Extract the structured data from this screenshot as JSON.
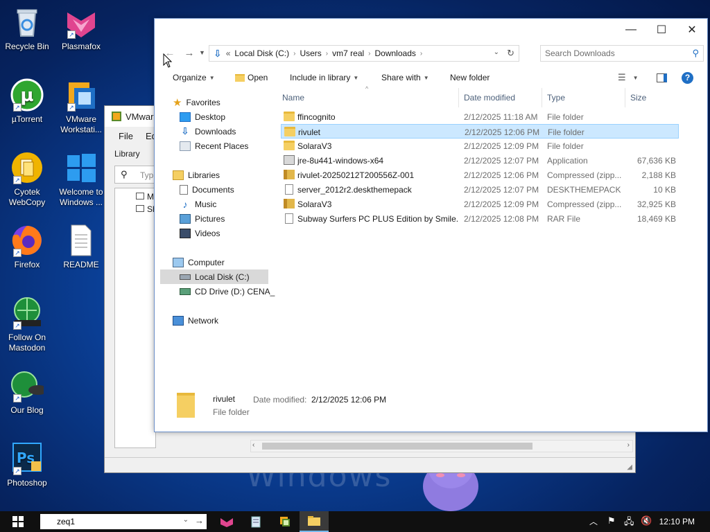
{
  "desktop": {
    "icons": [
      {
        "label": "Recycle Bin"
      },
      {
        "label": "Plasmafox"
      },
      {
        "label": "µTorrent"
      },
      {
        "label": "VMware Workstati..."
      },
      {
        "label": "Cyotek WebCopy"
      },
      {
        "label": "Welcome to Windows ..."
      },
      {
        "label": "Firefox"
      },
      {
        "label": "README"
      },
      {
        "label": "Follow On Mastodon"
      },
      {
        "label": "Our Blog"
      },
      {
        "label": "Photoshop"
      }
    ]
  },
  "vmware": {
    "title": "VMware",
    "menu": [
      "File",
      "Edit"
    ],
    "library_label": "Library",
    "search_placeholder": "Typ",
    "tree": [
      "M",
      "Sh"
    ]
  },
  "explorer": {
    "address": {
      "prefix": "«",
      "crumbs": [
        "Local Disk (C:)",
        "Users",
        "vm7 real",
        "Downloads"
      ]
    },
    "search_placeholder": "Search Downloads",
    "toolbar": {
      "organize": "Organize",
      "open": "Open",
      "include": "Include in library",
      "share": "Share with",
      "new_folder": "New folder"
    },
    "nav": {
      "favorites": "Favorites",
      "desktop": "Desktop",
      "downloads": "Downloads",
      "recent": "Recent Places",
      "libraries": "Libraries",
      "documents": "Documents",
      "music": "Music",
      "pictures": "Pictures",
      "videos": "Videos",
      "computer": "Computer",
      "local_disk": "Local Disk (C:)",
      "cd_drive": "CD Drive (D:) CENA_",
      "network": "Network"
    },
    "columns": {
      "name": "Name",
      "date": "Date modified",
      "type": "Type",
      "size": "Size"
    },
    "files": [
      {
        "name": "ffincognito",
        "date": "2/12/2025 11:18 AM",
        "type": "File folder",
        "size": "",
        "icon": "folder"
      },
      {
        "name": "rivulet",
        "date": "2/12/2025 12:06 PM",
        "type": "File folder",
        "size": "",
        "icon": "folder"
      },
      {
        "name": "SolaraV3",
        "date": "2/12/2025 12:09 PM",
        "type": "File folder",
        "size": "",
        "icon": "folder"
      },
      {
        "name": "jre-8u441-windows-x64",
        "date": "2/12/2025 12:07 PM",
        "type": "Application",
        "size": "67,636 KB",
        "icon": "app"
      },
      {
        "name": "rivulet-20250212T200556Z-001",
        "date": "2/12/2025 12:06 PM",
        "type": "Compressed (zipp...",
        "size": "2,188 KB",
        "icon": "archive"
      },
      {
        "name": "server_2012r2.deskthemepack",
        "date": "2/12/2025 12:07 PM",
        "type": "DESKTHEMEPACK ...",
        "size": "10 KB",
        "icon": "doc"
      },
      {
        "name": "SolaraV3",
        "date": "2/12/2025 12:09 PM",
        "type": "Compressed (zipp...",
        "size": "32,925 KB",
        "icon": "archive"
      },
      {
        "name": "Subway Surfers PC PLUS Edition by Smile...",
        "date": "2/12/2025 12:08 PM",
        "type": "RAR File",
        "size": "18,469 KB",
        "icon": "doc"
      }
    ],
    "details": {
      "name": "rivulet",
      "date_label": "Date modified:",
      "date_value": "2/12/2025 12:06 PM",
      "type": "File folder"
    }
  },
  "taskbar": {
    "search_value": "zeq1",
    "clock": "12:10 PM"
  },
  "wallpaper_text": "Windows"
}
